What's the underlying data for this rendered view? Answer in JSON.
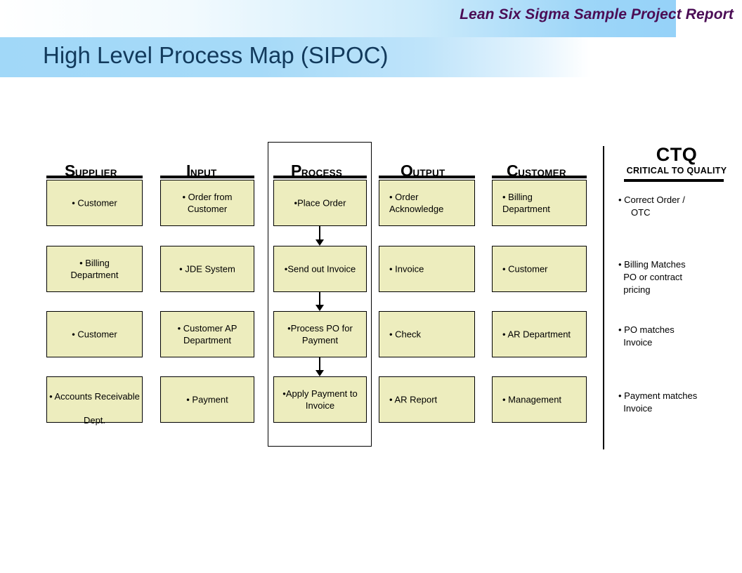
{
  "header": {
    "kicker": "Lean Six Sigma Sample Project Report",
    "title": "High Level Process Map (SIPOC)",
    "kicker_color": "#4B0D55",
    "title_color": "#123A5C",
    "band_color": "#A1D8F8"
  },
  "diagram": {
    "box_fill": "#EDEDBE",
    "box_border": "#000000",
    "columns": [
      {
        "id": "supplier",
        "head_cap": "S",
        "head_rest": "UPPLIER",
        "items": [
          "• Customer",
          "• Billing\nDepartment",
          "• Customer",
          "• Accounts Receivable\n\nDept."
        ]
      },
      {
        "id": "input",
        "head_cap": "I",
        "head_rest": "NPUT",
        "items": [
          "• Order from\nCustomer",
          "• JDE System",
          "• Customer AP\nDepartment",
          "• Payment"
        ]
      },
      {
        "id": "process",
        "head_cap": "P",
        "head_rest": "ROCESS",
        "items": [
          "•Place Order",
          "•Send out Invoice",
          "•Process PO for\nPayment",
          "•Apply Payment to\nInvoice"
        ]
      },
      {
        "id": "output",
        "head_cap": "O",
        "head_rest": "UTPUT",
        "items": [
          "• Order\nAcknowledge",
          "• Invoice",
          "• Check",
          "• AR Report"
        ]
      },
      {
        "id": "customer",
        "head_cap": "C",
        "head_rest": "USTOMER",
        "items": [
          "• Billing\nDepartment",
          "• Customer",
          "• AR Department",
          "• Management"
        ]
      }
    ]
  },
  "ctq": {
    "title": "CTQ",
    "subtitle": "CRITICAL TO QUALITY",
    "items": [
      "• Correct Order /\n     OTC",
      "• Billing Matches\n  PO or contract\n  pricing",
      "• PO matches\n  Invoice",
      "• Payment matches\n  Invoice"
    ]
  }
}
